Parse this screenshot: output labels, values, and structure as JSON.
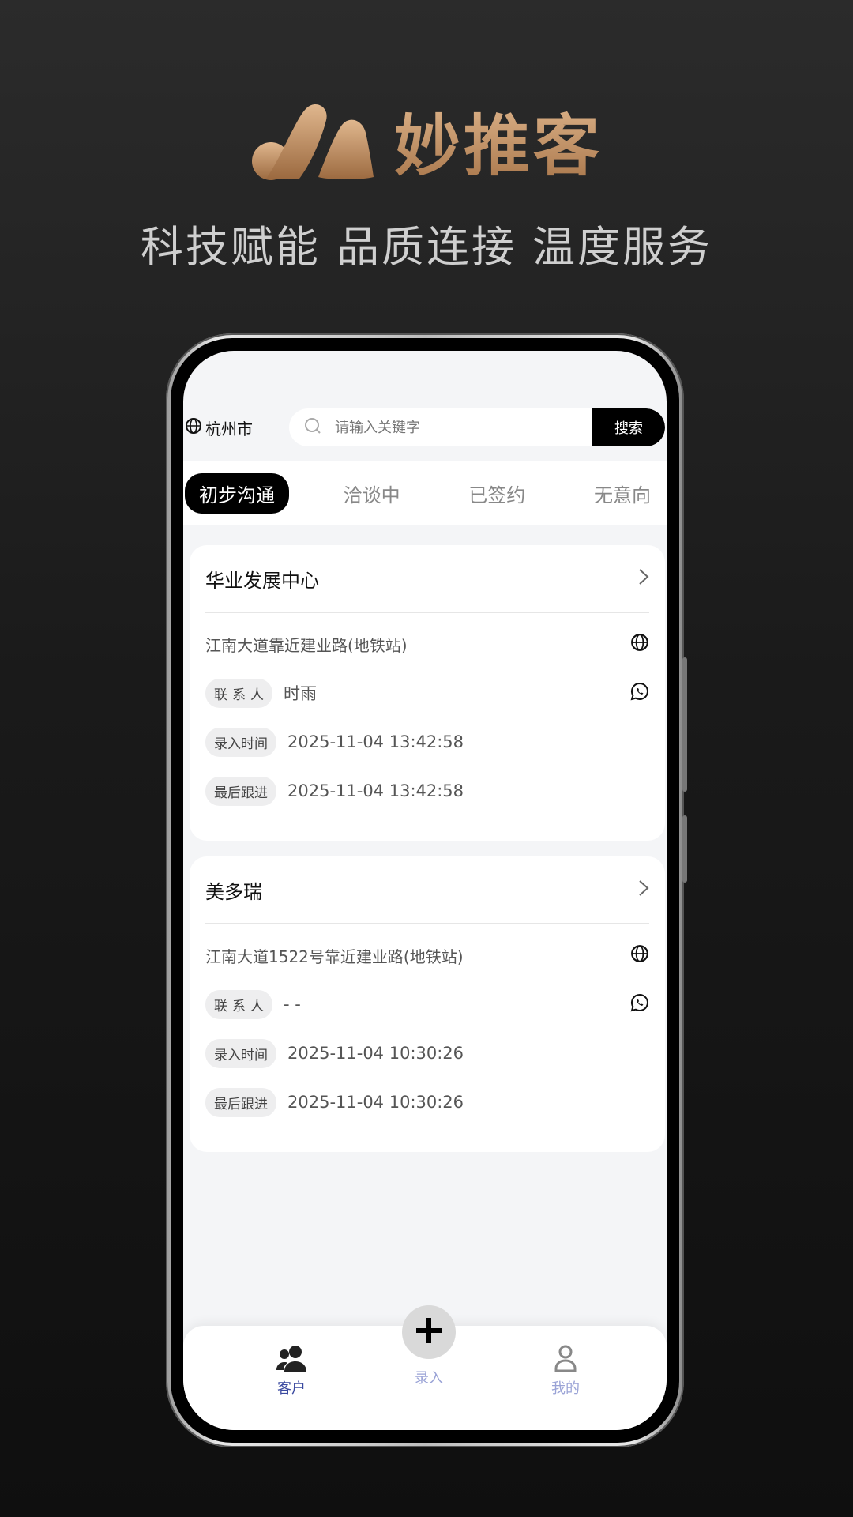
{
  "brand": {
    "name": "妙推客",
    "slogan": "科技赋能 品质连接 温度服务"
  },
  "header": {
    "city": "杭州市",
    "search_placeholder": "请输入关键字",
    "search_button": "搜索"
  },
  "tabs": [
    {
      "label": "初步沟通",
      "active": true
    },
    {
      "label": "洽谈中"
    },
    {
      "label": "已签约"
    },
    {
      "label": "无意向"
    }
  ],
  "labels": {
    "contact": "联系人",
    "entry_time": "录入时间",
    "last_follow": "最后跟进"
  },
  "cards": [
    {
      "name": "华业发展中心",
      "address": "江南大道靠近建业路(地铁站)",
      "contact": "时雨",
      "entry_time": "2025-11-04 13:42:58",
      "last_follow": "2025-11-04 13:42:58"
    },
    {
      "name": "美多瑞",
      "address": "江南大道1522号靠近建业路(地铁站)",
      "contact": "- -",
      "entry_time": "2025-11-04 10:30:26",
      "last_follow": "2025-11-04 10:30:26"
    }
  ],
  "nav": {
    "customers": "客户",
    "add": "录入",
    "mine": "我的"
  },
  "colors": {
    "brand_gold": "#c8976a",
    "nav_active": "#3b4aa0",
    "nav_inactive": "#9aa3d6"
  }
}
